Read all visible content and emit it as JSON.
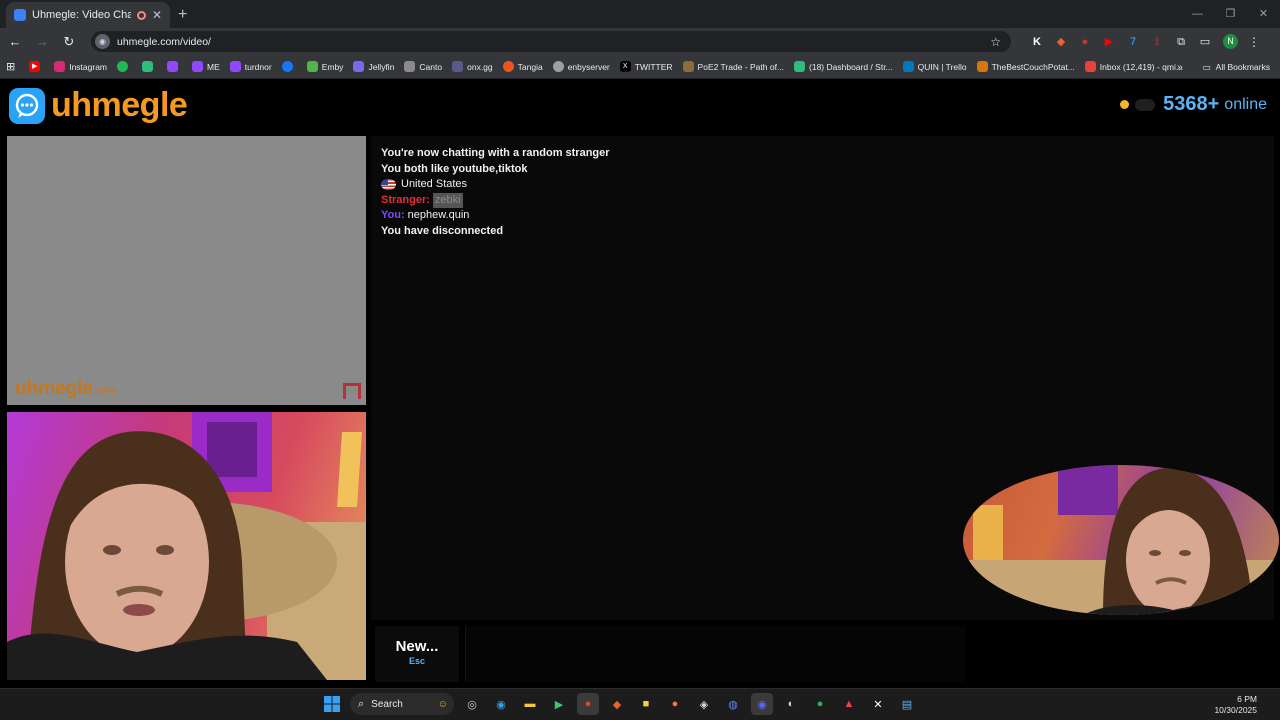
{
  "browser": {
    "tab_title": "Uhmegle: Video Chat | Ran",
    "tab_close": "✕",
    "new_tab": "+",
    "url": "uhmegle.com/video/",
    "profile_initial": "N",
    "window_controls": [
      "—",
      "❐",
      "✕"
    ],
    "bookmarks": [
      {
        "label": "Instagram",
        "color": "#d62976"
      },
      {
        "label": "",
        "color": "#1db954"
      },
      {
        "label": "",
        "color": "#2ebd7a"
      },
      {
        "label": "",
        "color": "#9146ff"
      },
      {
        "label": "ME",
        "color": "#9146ff"
      },
      {
        "label": "turdnor",
        "color": "#9146ff"
      },
      {
        "label": "",
        "color": "#1877f2"
      },
      {
        "label": "Emby",
        "color": "#52b54b"
      },
      {
        "label": "Jellyfin",
        "color": "#7b68ee"
      },
      {
        "label": "Canto",
        "color": "#8a8a8a"
      },
      {
        "label": "onx.gg",
        "color": "#5a5a8a"
      },
      {
        "label": "Tangia",
        "color": "#f4511e"
      },
      {
        "label": "enbyserver",
        "color": "#9aa0a6"
      },
      {
        "label": "TWITTER",
        "color": "#000000"
      },
      {
        "label": "PoE2 Trade - Path of...",
        "color": "#8a6d3b"
      },
      {
        "label": "(18) Dashboard / Str...",
        "color": "#2ebd7a"
      },
      {
        "label": "QUIN | Trello",
        "color": "#0079bf"
      },
      {
        "label": "TheBestCouchPotat...",
        "color": "#d97706"
      },
      {
        "label": "Inbox (12,419) - qmi...",
        "color": "#ea4335"
      }
    ],
    "bookmarks_more": "»",
    "all_bookmarks": "All Bookmarks"
  },
  "site": {
    "logo_text": "uhmegle",
    "online_count": "5368+",
    "online_label": "online",
    "watermark_main": "uhmegle",
    "watermark_suffix": ".com"
  },
  "chat": {
    "line1": "You're now chatting with a random stranger",
    "line2": "You both like youtube,tiktok",
    "country": "United States",
    "stranger_label": "Stranger:",
    "stranger_msg": "zebki",
    "you_label": "You:",
    "you_msg": "nephew.quin",
    "line_disconnect": "You have disconnected"
  },
  "controls": {
    "new_label": "New...",
    "new_key": "Esc"
  },
  "taskbar": {
    "search_label": "Search",
    "time": "6 PM",
    "date": "10/30/2025"
  }
}
